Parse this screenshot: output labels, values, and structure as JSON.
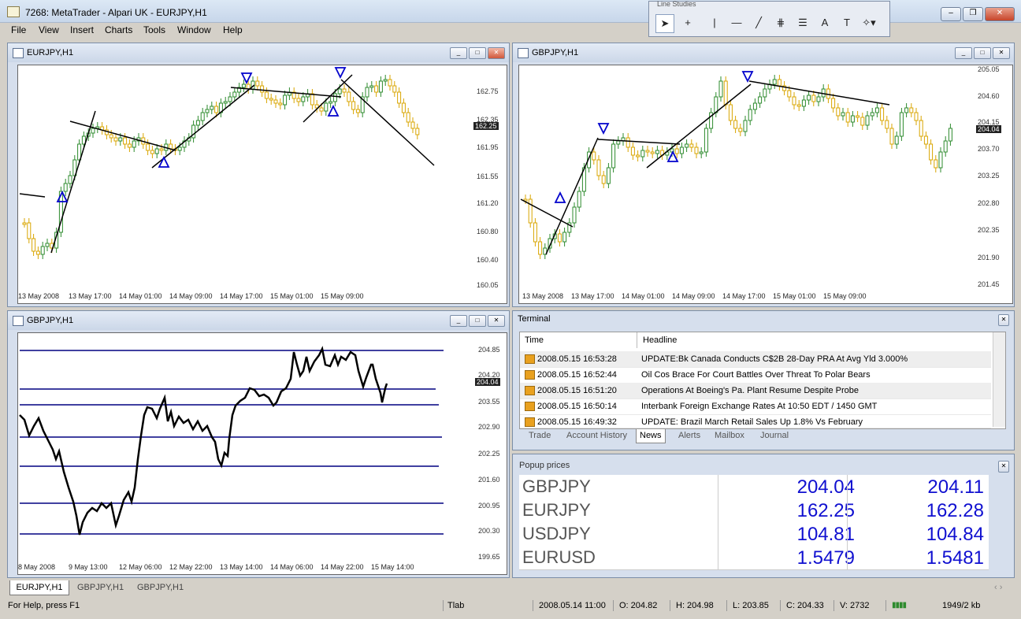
{
  "window": {
    "title": "7268: MetaTrader - Alpari UK - EURJPY,H1"
  },
  "menu": [
    "File",
    "View",
    "Insert",
    "Charts",
    "Tools",
    "Window",
    "Help"
  ],
  "toolbar": {
    "title": "Line Studies",
    "text_tool": "A"
  },
  "charts": {
    "eurjpy": {
      "title": "EURJPY,H1",
      "prices": [
        "162.75",
        "162.35",
        "161.95",
        "161.55",
        "161.20",
        "160.80",
        "160.40",
        "160.05"
      ],
      "current": "162.25",
      "times": [
        "13 May 2008",
        "13 May 17:00",
        "14 May 01:00",
        "14 May 09:00",
        "14 May 17:00",
        "15 May 01:00",
        "15 May 09:00"
      ]
    },
    "gbpjpy": {
      "title": "GBPJPY,H1",
      "prices": [
        "205.05",
        "204.60",
        "204.15",
        "203.70",
        "203.25",
        "202.80",
        "202.35",
        "201.90",
        "201.45"
      ],
      "current": "204.04",
      "times": [
        "13 May 2008",
        "13 May 17:00",
        "14 May 01:00",
        "14 May 09:00",
        "14 May 17:00",
        "15 May 01:00",
        "15 May 09:00"
      ]
    },
    "gbpjpy_line": {
      "title": "GBPJPY,H1",
      "prices": [
        "204.85",
        "204.20",
        "203.55",
        "202.90",
        "202.25",
        "201.60",
        "200.95",
        "200.30",
        "199.65"
      ],
      "current": "204.04",
      "times": [
        "8 May 2008",
        "9 May 13:00",
        "12 May 06:00",
        "12 May 22:00",
        "13 May 14:00",
        "14 May 06:00",
        "14 May 22:00",
        "15 May 14:00"
      ]
    }
  },
  "terminal": {
    "title": "Terminal",
    "columns": [
      "Time",
      "Headline"
    ],
    "rows": [
      {
        "time": "2008.05.15 16:53:28",
        "headline": "UPDATE:Bk Canada Conducts C$2B 28-Day PRA At Avg Yld 3.000%"
      },
      {
        "time": "2008.05.15 16:52:44",
        "headline": "Oil Cos Brace For Court Battles Over Threat To Polar Bears"
      },
      {
        "time": "2008.05.15 16:51:20",
        "headline": "Operations At Boeing's Pa. Plant Resume Despite Probe"
      },
      {
        "time": "2008.05.15 16:50:14",
        "headline": "Interbank Foreign Exchange Rates At 10:50 EDT / 1450 GMT"
      },
      {
        "time": "2008.05.15 16:49:32",
        "headline": "UPDATE: Brazil March Retail Sales Up 1.8% Vs February"
      }
    ],
    "tabs": [
      "Trade",
      "Account History",
      "News",
      "Alerts",
      "Mailbox",
      "Journal"
    ],
    "active_tab": "News"
  },
  "popup": {
    "title": "Popup prices",
    "rows": [
      {
        "symbol": "GBPJPY",
        "bid": "204.04",
        "ask": "204.11"
      },
      {
        "symbol": "EURJPY",
        "bid": "162.25",
        "ask": "162.28"
      },
      {
        "symbol": "USDJPY",
        "bid": "104.81",
        "ask": "104.84"
      },
      {
        "symbol": "EURUSD",
        "bid": "1.5479",
        "ask": "1.5481"
      }
    ]
  },
  "bottom_tabs": [
    "EURJPY,H1",
    "GBPJPY,H1",
    "GBPJPY,H1"
  ],
  "status": {
    "help": "For Help, press F1",
    "profile": "Tlab",
    "datetime": "2008.05.14 11:00",
    "open": "O: 204.82",
    "high": "H: 204.98",
    "low": "L: 203.85",
    "close": "C: 204.33",
    "volume": "V: 2732",
    "traffic": "1949/2 kb"
  },
  "colors": {
    "bull": "#2e8b2e",
    "bear": "#d9a500",
    "line": "#000000",
    "level": "#000080",
    "arrow": "#0000cc"
  }
}
